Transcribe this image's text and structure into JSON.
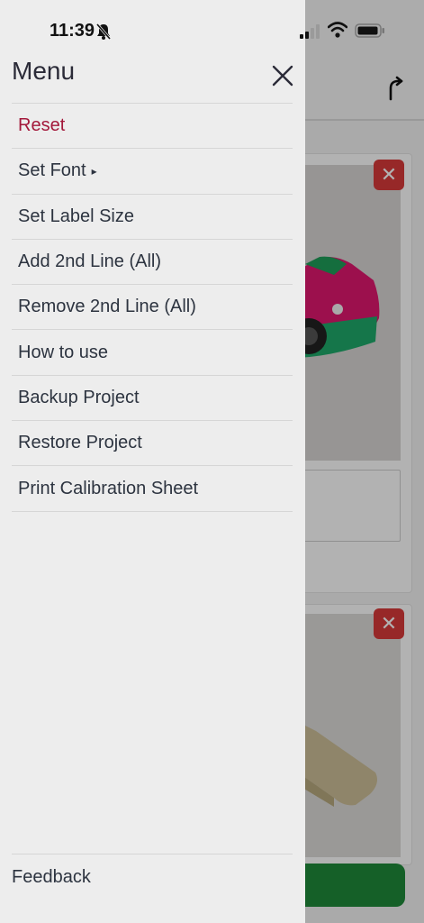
{
  "status_bar": {
    "time": "11:39"
  },
  "menu": {
    "title": "Menu",
    "items": [
      {
        "label": "Reset"
      },
      {
        "label": "Set Font",
        "submenu": true
      },
      {
        "label": "Set Label Size"
      },
      {
        "label": "Add 2nd Line (All)"
      },
      {
        "label": "Remove 2nd Line (All)"
      },
      {
        "label": "How to use"
      },
      {
        "label": "Backup Project"
      },
      {
        "label": "Restore Project"
      },
      {
        "label": "Print Calibration Sheet"
      }
    ],
    "feedback_label": "Feedback"
  },
  "background": {
    "close_glyph": "✕"
  },
  "colors": {
    "reset_text": "#a3183a",
    "drawer_bg": "#ededed",
    "remove_button": "#d93a3a",
    "primary_button": "#1f8a3a"
  }
}
